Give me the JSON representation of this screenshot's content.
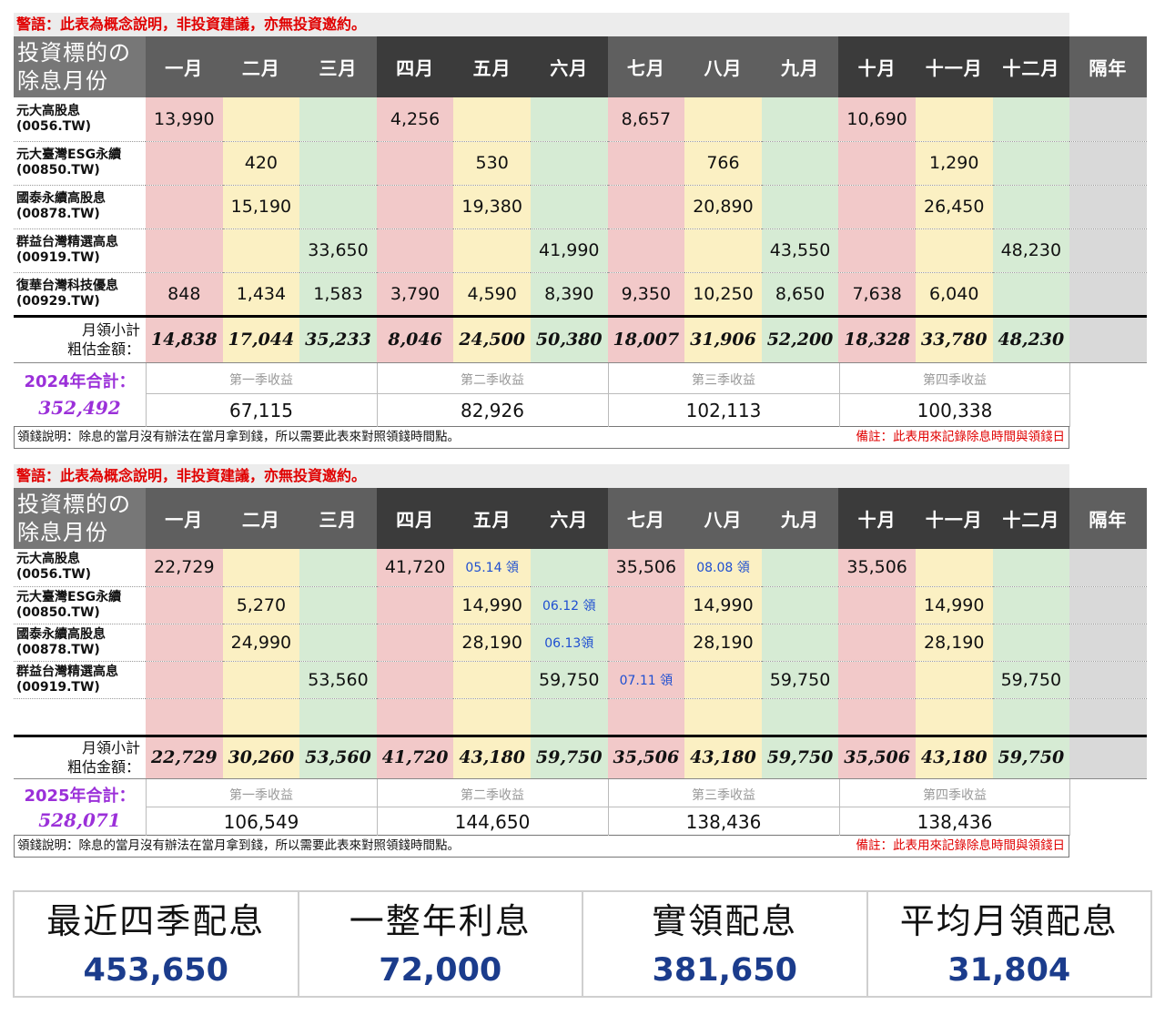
{
  "columns": [
    "一月",
    "二月",
    "三月",
    "四月",
    "五月",
    "六月",
    "七月",
    "八月",
    "九月",
    "十月",
    "十一月",
    "十二月",
    "隔年"
  ],
  "header_name": [
    "投資標的の",
    "除息月份"
  ],
  "subtotal_label": [
    "月領小計",
    "粗估金額："
  ],
  "warning": "警語：此表為概念說明，非投資建議，亦無投資邀約。",
  "quarter_labels": [
    "第一季收益",
    "第二季收益",
    "第三季收益",
    "第四季收益"
  ],
  "note_left": "領錢說明：除息的當月沒有辦法在當月拿到錢，所以需要此表來對照領錢時間點。",
  "note_right": "備註：此表用來記錄除息時間與領錢日",
  "table_2024": {
    "rows": [
      {
        "name": [
          "元大高股息",
          "(0056.TW)"
        ],
        "cells": [
          "13,990",
          "",
          "",
          "4,256",
          "",
          "",
          "8,657",
          "",
          "",
          "10,690",
          "",
          "",
          ""
        ]
      },
      {
        "name": [
          "元大臺灣ESG永續",
          "(00850.TW)"
        ],
        "cells": [
          "",
          "420",
          "",
          "",
          "530",
          "",
          "",
          "766",
          "",
          "",
          "1,290",
          "",
          ""
        ]
      },
      {
        "name": [
          "國泰永續高股息",
          "(00878.TW)"
        ],
        "cells": [
          "",
          "15,190",
          "",
          "",
          "19,380",
          "",
          "",
          "20,890",
          "",
          "",
          "26,450",
          "",
          ""
        ]
      },
      {
        "name": [
          "群益台灣精選高息",
          "(00919.TW)"
        ],
        "cells": [
          "",
          "",
          "33,650",
          "",
          "",
          "41,990",
          "",
          "",
          "43,550",
          "",
          "",
          "48,230",
          ""
        ]
      },
      {
        "name": [
          "復華台灣科技優息",
          "(00929.TW)"
        ],
        "cells": [
          "848",
          "1,434",
          "1,583",
          "3,790",
          "4,590",
          "8,390",
          "9,350",
          "10,250",
          "8,650",
          "7,638",
          "6,040",
          "",
          ""
        ]
      }
    ],
    "subtotals": [
      "14,838",
      "17,044",
      "35,233",
      "8,046",
      "24,500",
      "50,380",
      "18,007",
      "31,906",
      "52,200",
      "18,328",
      "33,780",
      "48,230",
      ""
    ],
    "total_label": "2024年合計：",
    "total_value": "352,492",
    "quarter_values": [
      "67,115",
      "82,926",
      "102,113",
      "100,338"
    ]
  },
  "table_2025": {
    "rows": [
      {
        "name": [
          "元大高股息",
          "(0056.TW)"
        ],
        "cells": [
          "22,729",
          "",
          "",
          "41,720",
          "05.14 領",
          "",
          "35,506",
          "08.08 領",
          "",
          "35,506",
          "",
          "",
          ""
        ]
      },
      {
        "name": [
          "元大臺灣ESG永續",
          "(00850.TW)"
        ],
        "cells": [
          "",
          "5,270",
          "",
          "",
          "14,990",
          "06.12 領",
          "",
          "14,990",
          "",
          "",
          "14,990",
          "",
          ""
        ]
      },
      {
        "name": [
          "國泰永續高股息",
          "(00878.TW)"
        ],
        "cells": [
          "",
          "24,990",
          "",
          "",
          "28,190",
          "06.13領",
          "",
          "28,190",
          "",
          "",
          "28,190",
          "",
          ""
        ]
      },
      {
        "name": [
          "群益台灣精選高息",
          "(00919.TW)"
        ],
        "cells": [
          "",
          "",
          "53,560",
          "",
          "",
          "59,750",
          "07.11 領",
          "",
          "59,750",
          "",
          "",
          "59,750",
          ""
        ]
      },
      {
        "name": [
          "",
          ""
        ],
        "cells": [
          "",
          "",
          "",
          "",
          "",
          "",
          "",
          "",
          "",
          "",
          "",
          "",
          ""
        ]
      }
    ],
    "subtotals": [
      "22,729",
      "30,260",
      "53,560",
      "41,720",
      "43,180",
      "59,750",
      "35,506",
      "43,180",
      "59,750",
      "35,506",
      "43,180",
      "59,750",
      ""
    ],
    "total_label": "2025年合計：",
    "total_value": "528,071",
    "quarter_values": [
      "106,549",
      "144,650",
      "138,436",
      "138,436"
    ]
  },
  "summary": [
    {
      "label": "最近四季配息",
      "value": "453,650"
    },
    {
      "label": "一整年利息",
      "value": "72,000"
    },
    {
      "label": "實領配息",
      "value": "381,650"
    },
    {
      "label": "平均月領配息",
      "value": "31,804"
    }
  ]
}
